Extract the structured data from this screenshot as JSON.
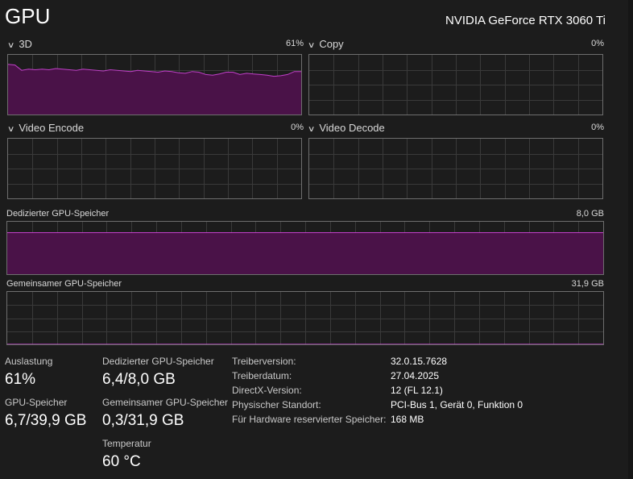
{
  "header": {
    "title": "GPU",
    "model": "NVIDIA GeForce RTX 3060 Ti"
  },
  "graphs": {
    "g3d": {
      "label": "3D",
      "value": "61%",
      "series": [
        84,
        83,
        74,
        76,
        75,
        76,
        75,
        77,
        76,
        75,
        74,
        76,
        75,
        74,
        73,
        75,
        74,
        73,
        72,
        74,
        73,
        72,
        71,
        73,
        72,
        70,
        69,
        72,
        71,
        67,
        66,
        68,
        71,
        71,
        67,
        69,
        68,
        67,
        66,
        64,
        65,
        67,
        72,
        72
      ]
    },
    "copy": {
      "label": "Copy",
      "value": "0%"
    },
    "vencode": {
      "label": "Video Encode",
      "value": "0%"
    },
    "vdecode": {
      "label": "Video Decode",
      "value": "0%"
    }
  },
  "memory": {
    "dedicated": {
      "label": "Dedizierter GPU-Speicher",
      "capacity": "8,0 GB",
      "fill_fraction": 0.8
    },
    "shared": {
      "label": "Gemeinsamer GPU-Speicher",
      "capacity": "31,9 GB",
      "fill_fraction": 0.01
    }
  },
  "stats": {
    "auslastung": {
      "label": "Auslastung",
      "value": "61%"
    },
    "gpu_speicher": {
      "label": "GPU-Speicher",
      "value": "6,7/39,9 GB"
    },
    "dedicated": {
      "label": "Dedizierter GPU-Speicher",
      "value": "6,4/8,0 GB"
    },
    "shared": {
      "label": "Gemeinsamer GPU-Speicher",
      "value": "0,3/31,9 GB"
    },
    "temp": {
      "label": "Temperatur",
      "value": "60 °C"
    }
  },
  "info": [
    {
      "key": "Treiberversion:",
      "value": "32.0.15.7628"
    },
    {
      "key": "Treiberdatum:",
      "value": "27.04.2025"
    },
    {
      "key": "DirectX-Version:",
      "value": "12 (FL 12.1)"
    },
    {
      "key": "Physischer Standort:",
      "value": "PCI-Bus 1, Gerät 0, Funktion 0"
    },
    {
      "key": "Für Hardware reservierter Speicher:",
      "value": "168 MB"
    }
  ],
  "colors": {
    "accent": "#c040c8",
    "fill": "#4a1248",
    "grid": "#3a3a3a",
    "border": "#6e6e6e"
  }
}
